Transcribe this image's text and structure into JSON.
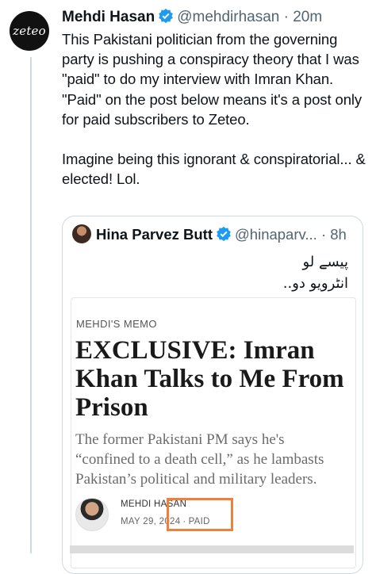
{
  "tweet": {
    "avatar_text": "zeteo",
    "author_name": "Mehdi Hasan",
    "handle": "@mehdirhasan",
    "separator": "·",
    "time": "20m",
    "paragraphs": [
      "This Pakistani politician from the governing party is pushing a conspiracy theory that I was \"paid\" to do my interview with Imran Khan.",
      "\"Paid\" on the post below means it's a post only for paid subscribers to Zeteo.",
      "",
      "Imagine being this ignorant & conspiratorial... & elected! Lol."
    ]
  },
  "quote": {
    "author_name": "Hina Parvez Butt",
    "handle": "@hinaparv...",
    "separator": "·",
    "time": "8h",
    "urdu_lines": [
      "پیسے لو",
      "انٹرویو دو.."
    ],
    "article": {
      "section": "MEHDI'S MEMO",
      "title": "EXCLUSIVE: Imran Khan Talks to Me From Prison",
      "subtitle": "The former Pakistani PM says he's “confined to a death cell,” as he lambasts Pakistan’s political and military leaders.",
      "author": "MEHDI HASAN",
      "date": "MAY 29, 2024",
      "date_sep": "·",
      "badge": "PAID"
    }
  },
  "colors": {
    "highlight": "#f07f3c",
    "verified": "#1d9bf0"
  }
}
